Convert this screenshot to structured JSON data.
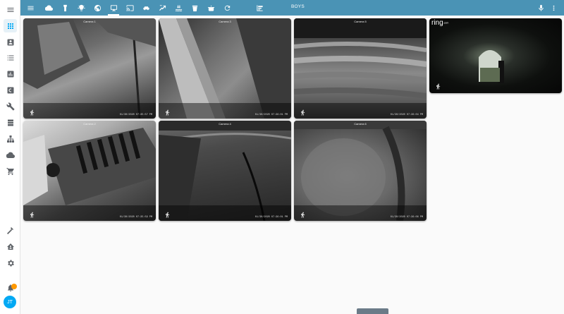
{
  "app": {
    "view_title": "BOYS",
    "accent_color": "#03a9f4",
    "topbar_color": "#4a93b5"
  },
  "topbar": {
    "menu_icon": "menu-icon",
    "views": [
      {
        "icon": "weather-cloud-icon",
        "active": false
      },
      {
        "icon": "light-strip-icon",
        "active": false
      },
      {
        "icon": "lightbulb-icon",
        "active": false
      },
      {
        "icon": "globe-icon",
        "active": false
      },
      {
        "icon": "monitor-icon",
        "active": true
      },
      {
        "icon": "cast-icon",
        "active": false
      },
      {
        "icon": "car-icon",
        "active": false
      },
      {
        "icon": "plant-icon",
        "active": false
      },
      {
        "icon": "pool-icon",
        "active": false
      },
      {
        "icon": "trash-can-icon",
        "active": false
      },
      {
        "icon": "pot-icon",
        "active": false
      },
      {
        "icon": "refresh-icon",
        "active": false
      },
      {
        "icon": "view-dashboard-icon",
        "active": false
      }
    ],
    "right_icons": [
      "microphone-icon",
      "more-vert-icon"
    ]
  },
  "sidebar": {
    "top_items": [
      {
        "icon": "overview-icon",
        "active": true
      },
      {
        "icon": "map-icon",
        "active": false
      },
      {
        "icon": "logbook-icon",
        "active": false
      },
      {
        "icon": "history-icon",
        "active": false
      },
      {
        "icon": "hacs-icon",
        "active": false
      },
      {
        "icon": "wrench-icon",
        "active": false
      },
      {
        "icon": "server-icon",
        "active": false
      },
      {
        "icon": "sitemap-icon",
        "active": false
      },
      {
        "icon": "cloud-icon",
        "active": false
      },
      {
        "icon": "cart-icon",
        "active": false
      }
    ],
    "bottom_items": [
      {
        "icon": "hammer-icon"
      },
      {
        "icon": "home-assistant-icon"
      },
      {
        "icon": "settings-icon"
      }
    ],
    "user_initials": "JT"
  },
  "cameras": [
    {
      "title": "Camera 1",
      "timestamp": "01/30/2020 07:35:57 PM"
    },
    {
      "title": "Camera 3",
      "timestamp": "01/30/2020 07:36:01 PM"
    },
    {
      "title": "Camera 5",
      "timestamp": "01/30/2020 07:36:04 PM"
    },
    {
      "title": "Camera 2",
      "timestamp": "01/30/2020 07:35:59 PM"
    },
    {
      "title": "Camera 4",
      "timestamp": "01/30/2020 07:36:01 PM"
    },
    {
      "title": "Camera 6",
      "timestamp": "01/30/2020 07:36:06 PM"
    }
  ],
  "ring": {
    "logo": "ring",
    "logo_suffix": ".com"
  }
}
